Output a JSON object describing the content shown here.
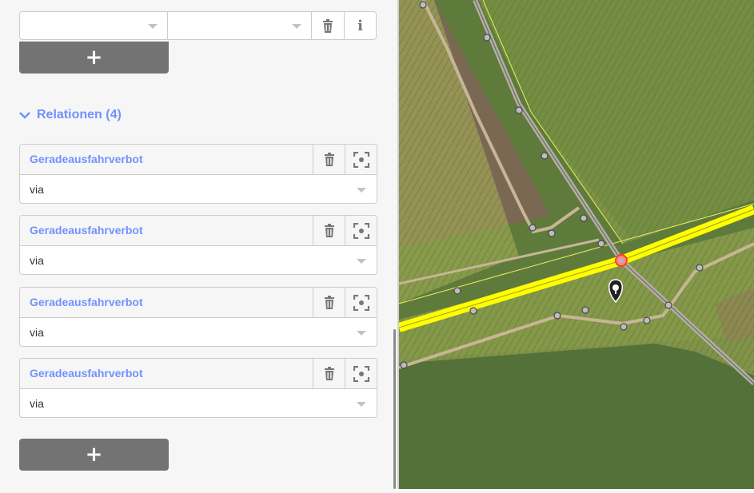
{
  "tags": {
    "key_placeholder": "",
    "value_placeholder": "",
    "add_button": "+"
  },
  "relations": {
    "title": "Relationen (4)",
    "items": [
      {
        "name": "Geradeausfahrverbot",
        "role": "via"
      },
      {
        "name": "Geradeausfahrverbot",
        "role": "via"
      },
      {
        "name": "Geradeausfahrverbot",
        "role": "via"
      },
      {
        "name": "Geradeausfahrverbot",
        "role": "via"
      }
    ],
    "add_button": "+"
  },
  "icons": {
    "delete": "trash-icon",
    "info": "info-icon",
    "zoom": "zoom-to-icon",
    "disclosure": "chevron-down-icon",
    "map_poi": "tree-pin-icon"
  },
  "colors": {
    "accent": "#7092ff",
    "button": "#737373",
    "highlight_road": "#ffff00",
    "selected_node": "#ff3b30"
  }
}
